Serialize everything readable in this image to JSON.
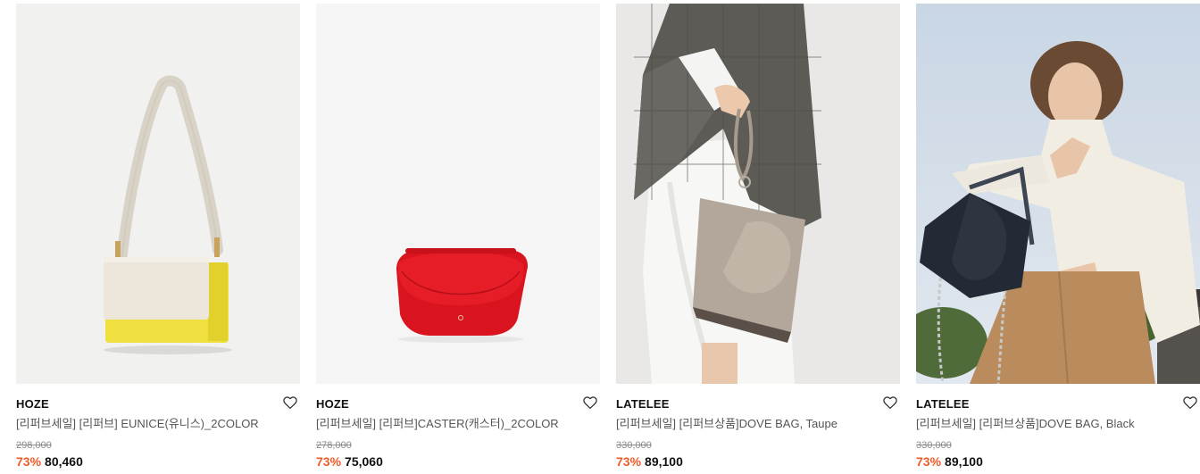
{
  "products": [
    {
      "brand": "HOZE",
      "title": "[리퍼브세일] [리퍼브] EUNICE(유니스)_2COLOR",
      "original_price": "298,000",
      "discount": "73%",
      "price": "80,460",
      "image_icon": "ivory-yellow-shoulder-bag-image"
    },
    {
      "brand": "HOZE",
      "title": "[리퍼브세일] [리퍼브]CASTER(캐스터)_2COLOR",
      "original_price": "278,000",
      "discount": "73%",
      "price": "75,060",
      "image_icon": "red-half-moon-bag-image"
    },
    {
      "brand": "LATELEE",
      "title": "[리퍼브세일] [리퍼브상품]DOVE BAG, Taupe",
      "original_price": "330,000",
      "discount": "73%",
      "price": "89,100",
      "image_icon": "model-taupe-bag-image"
    },
    {
      "brand": "LATELEE",
      "title": "[리퍼브세일] [리퍼브상품]DOVE BAG, Black",
      "original_price": "330,000",
      "discount": "73%",
      "price": "89,100",
      "image_icon": "model-black-bag-image"
    }
  ],
  "colors": {
    "discount": "#f25a29",
    "strikethrough": "#8a8a8a",
    "title": "#555555",
    "brand": "#111111"
  },
  "wishlist_icon": "heart-outline-icon"
}
